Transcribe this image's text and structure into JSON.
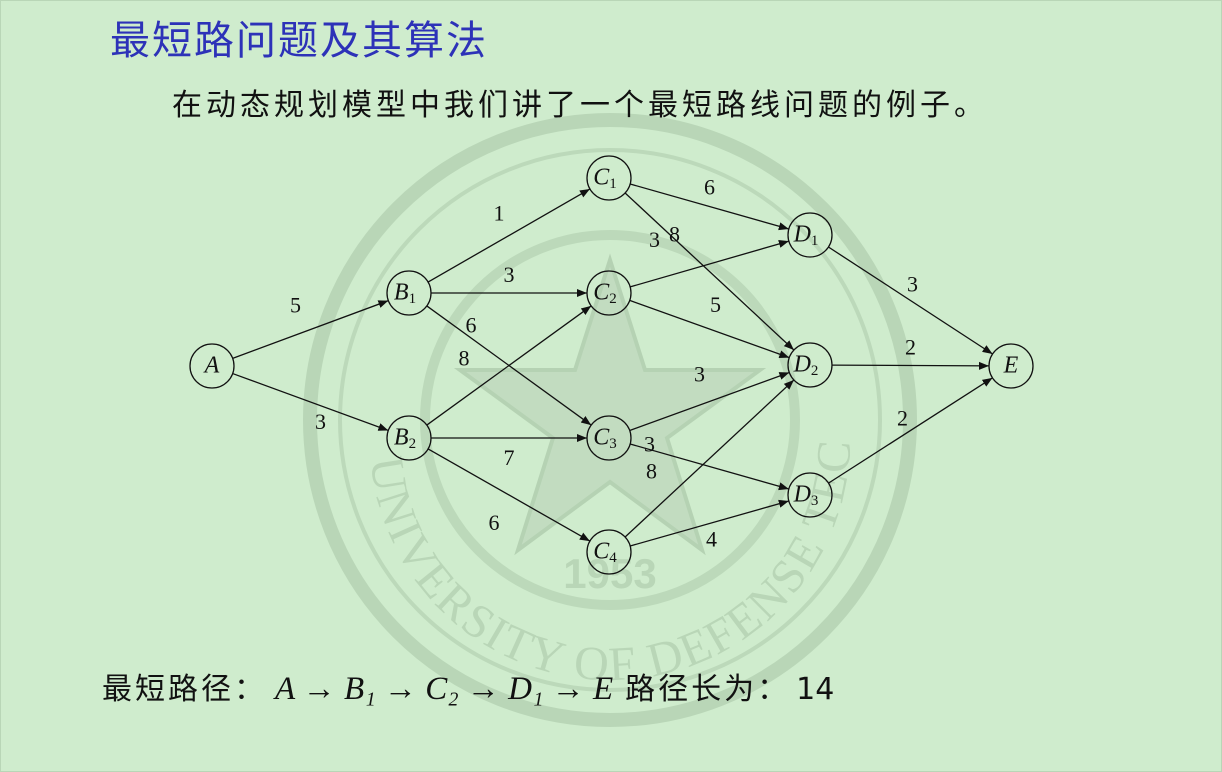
{
  "title": "最短路问题及其算法",
  "intro": "在动态规划模型中我们讲了一个最短路线问题的例子。",
  "watermark": {
    "text": "NATIONAL UNIVERSITY OF DEFENSE TECHNOLOGY",
    "year": "1953",
    "color": "#b9d6b7"
  },
  "graph": {
    "nodes": [
      {
        "id": "A",
        "name": "A",
        "sub": ""
      },
      {
        "id": "B1",
        "name": "B",
        "sub": "1"
      },
      {
        "id": "B2",
        "name": "B",
        "sub": "2"
      },
      {
        "id": "C1",
        "name": "C",
        "sub": "1"
      },
      {
        "id": "C2",
        "name": "C",
        "sub": "2"
      },
      {
        "id": "C3",
        "name": "C",
        "sub": "3"
      },
      {
        "id": "C4",
        "name": "C",
        "sub": "4"
      },
      {
        "id": "D1",
        "name": "D",
        "sub": "1"
      },
      {
        "id": "D2",
        "name": "D",
        "sub": "2"
      },
      {
        "id": "D3",
        "name": "D",
        "sub": "3"
      },
      {
        "id": "E",
        "name": "E",
        "sub": ""
      }
    ],
    "edges": [
      {
        "from": "A",
        "to": "B1",
        "weight": "5"
      },
      {
        "from": "A",
        "to": "B2",
        "weight": "3"
      },
      {
        "from": "B1",
        "to": "C1",
        "weight": "1"
      },
      {
        "from": "B1",
        "to": "C2",
        "weight": "3"
      },
      {
        "from": "B1",
        "to": "C3",
        "weight": "6"
      },
      {
        "from": "B2",
        "to": "C2",
        "weight": "8"
      },
      {
        "from": "B2",
        "to": "C3",
        "weight": "7"
      },
      {
        "from": "B2",
        "to": "C4",
        "weight": "6"
      },
      {
        "from": "C1",
        "to": "D1",
        "weight": "6"
      },
      {
        "from": "C1",
        "to": "D2",
        "weight": "8"
      },
      {
        "from": "C2",
        "to": "D1",
        "weight": "3"
      },
      {
        "from": "C2",
        "to": "D2",
        "weight": "5"
      },
      {
        "from": "C3",
        "to": "D2",
        "weight": "3"
      },
      {
        "from": "C3",
        "to": "D3",
        "weight": "3"
      },
      {
        "from": "C4",
        "to": "D2",
        "weight": "8"
      },
      {
        "from": "C4",
        "to": "D3",
        "weight": "4"
      },
      {
        "from": "D1",
        "to": "E",
        "weight": "3"
      },
      {
        "from": "D2",
        "to": "E",
        "weight": "2"
      },
      {
        "from": "D3",
        "to": "E",
        "weight": "2"
      }
    ]
  },
  "result": {
    "label": "最短路径：",
    "path": "A → B₁ → C₂ → D₁ → E",
    "length_label": "路径长为：",
    "length": "14"
  }
}
